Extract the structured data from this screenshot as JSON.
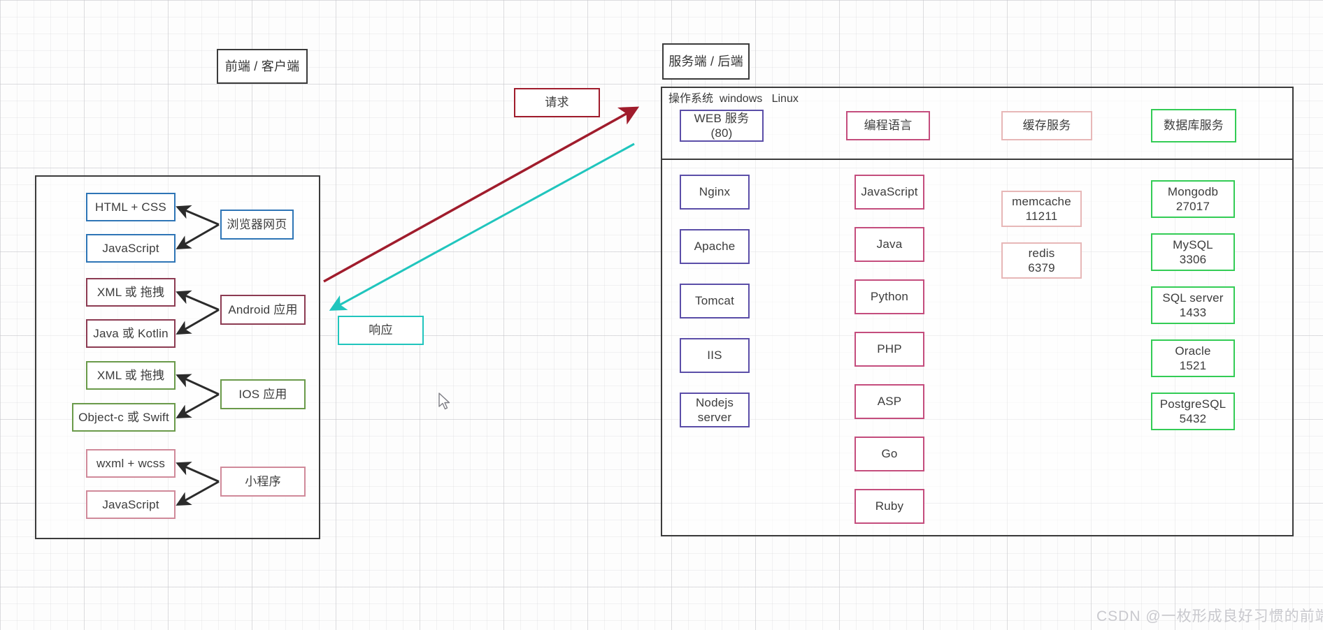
{
  "colors": {
    "dark": "#3b3b3b",
    "blue": "#2e75b6",
    "maroon": "#8c3b52",
    "green": "#6a9a4a",
    "rose": "#d08a9a",
    "purple": "#5b4ea8",
    "pink": "#c44d7d",
    "lightpink": "#e7b7b7",
    "brightgreen": "#33cc55",
    "red_arrow": "#a01c2c",
    "teal_arrow": "#20c5bd",
    "watermark": "#c9c9ce"
  },
  "client": {
    "title": "前端 / 客户端",
    "groups": [
      {
        "color": "blue",
        "target": "浏览器网页",
        "sources": [
          "HTML + CSS",
          "JavaScript"
        ]
      },
      {
        "color": "maroon",
        "target": "Android 应用",
        "sources": [
          "XML 或 拖拽",
          "Java 或 Kotlin"
        ]
      },
      {
        "color": "green",
        "target": "IOS 应用",
        "sources": [
          "XML 或 拖拽",
          "Object-c 或 Swift"
        ]
      },
      {
        "color": "rose",
        "target": "小程序",
        "sources": [
          "wxml + wcss",
          "JavaScript"
        ]
      }
    ]
  },
  "arrows": {
    "request_label": "请求",
    "response_label": "响应"
  },
  "server": {
    "title": "服务端 / 后端",
    "os_label": "操作系统  windows   Linux",
    "columns": [
      {
        "header": "WEB 服务\n(80)",
        "header_color": "purple",
        "item_color": "purple",
        "items": [
          "Nginx",
          "Apache",
          "Tomcat",
          "IIS",
          "Nodejs\nserver"
        ]
      },
      {
        "header": "编程语言",
        "header_color": "pink",
        "item_color": "pink",
        "items": [
          "JavaScript",
          "Java",
          "Python",
          "PHP",
          "ASP",
          "Go",
          "Ruby"
        ]
      },
      {
        "header": "缓存服务",
        "header_color": "lightpink",
        "item_color": "lightpink",
        "items": [
          "memcache\n11211",
          "redis\n6379"
        ]
      },
      {
        "header": "数据库服务",
        "header_color": "brightgreen",
        "item_color": "brightgreen",
        "items": [
          "Mongodb\n27017",
          "MySQL\n3306",
          "SQL server\n1433",
          "Oracle\n1521",
          "PostgreSQL\n5432"
        ]
      }
    ]
  },
  "watermark": "CSDN @一枚形成良好习惯的前端猿"
}
